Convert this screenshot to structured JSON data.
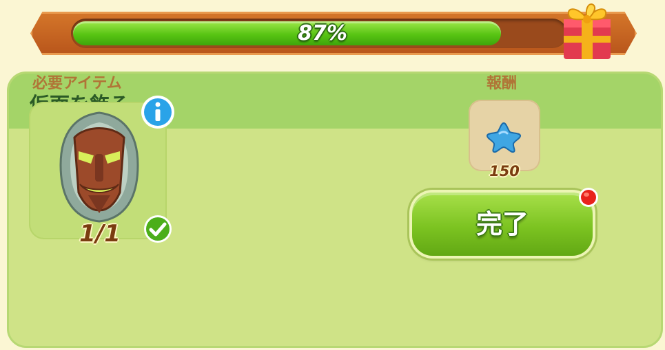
{
  "progress": {
    "value": 0.87,
    "label": "87%",
    "reward_icon": "gift-box-icon"
  },
  "panel": {
    "title": "仮面を飾る",
    "required_items": {
      "label": "必要アイテム",
      "item_icon": "tiki-mask-icon",
      "count": "1/1",
      "info_icon": "info-icon",
      "status_icon": "check-icon"
    },
    "reward": {
      "label": "報酬",
      "icon": "blue-star-icon",
      "amount": "150"
    },
    "complete_button": {
      "label": "完了",
      "has_notification": true
    }
  },
  "colors": {
    "progress_fill": "#58c413",
    "progress_frame": "#c8631f",
    "panel_bg": "#cfe387",
    "panel_header": "#a4d468",
    "title_text": "#2b5a26",
    "section_label": "#b07537",
    "button_green": "#7cc321",
    "notification_red": "#e8231c"
  }
}
